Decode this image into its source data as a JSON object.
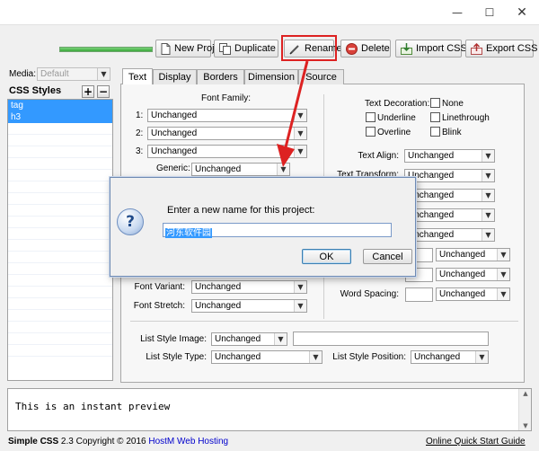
{
  "window": {
    "controls": {
      "minimize": "—",
      "maximize": "☐",
      "close": "✕"
    }
  },
  "toolbar": {
    "buttons": [
      {
        "id": "new_project",
        "label": "New Project",
        "icon": "document-icon"
      },
      {
        "id": "duplicate",
        "label": "Duplicate",
        "icon": "copy-icon"
      },
      {
        "id": "rename",
        "label": "Rename",
        "icon": "pencil-icon"
      },
      {
        "id": "delete",
        "label": "Delete",
        "icon": "delete-icon"
      },
      {
        "id": "import_css",
        "label": "Import CSS",
        "icon": "import-icon"
      },
      {
        "id": "export_css",
        "label": "Export CSS",
        "icon": "export-icon"
      }
    ],
    "highlight_color": "#dd2222"
  },
  "sidebar": {
    "media_label": "Media:",
    "media_value": "Default",
    "styles_title": "CSS Styles",
    "add_label": "+",
    "remove_label": "−",
    "items": [
      "tag",
      "h3"
    ]
  },
  "tabs": [
    "Text",
    "Display",
    "Borders",
    "Dimension",
    "Source"
  ],
  "active_tab": "Text",
  "font": {
    "family_title": "Font Family:",
    "rows": [
      {
        "label": "1:",
        "value": "Unchanged"
      },
      {
        "label": "2:",
        "value": "Unchanged"
      },
      {
        "label": "3:",
        "value": "Unchanged"
      }
    ],
    "generic_label": "Generic:",
    "generic_value": "Unchanged",
    "variant_label": "Font Variant:",
    "variant_value": "Unchanged",
    "stretch_label": "Font Stretch:",
    "stretch_value": "Unchanged"
  },
  "decoration": {
    "title": "Text Decoration:",
    "options": [
      "None",
      "Underline",
      "Linethrough",
      "Overline",
      "Blink"
    ]
  },
  "text_align": {
    "label": "Text Align:",
    "value": "Unchanged"
  },
  "text_transform": {
    "label": "Text Transform:",
    "value": "Unchanged"
  },
  "hidden_combos": [
    "Unchanged",
    "Unchanged",
    "Unchanged"
  ],
  "spacing_rows": [
    {
      "value": "Unchanged"
    },
    {
      "value": "Unchanged"
    },
    {
      "label": "Word Spacing:",
      "value": "Unchanged"
    }
  ],
  "list_style": {
    "image_label": "List Style Image:",
    "image_value": "Unchanged",
    "type_label": "List Style Type:",
    "type_value": "Unchanged",
    "position_label": "List Style Position:",
    "position_value": "Unchanged"
  },
  "preview": {
    "text": "This is an instant preview"
  },
  "status": {
    "app": "Simple CSS",
    "version_copy": " 2.3 Copyright © 2016 ",
    "company": "HostM",
    "company_suffix": " Web Hosting",
    "quick_start": "Online Quick Start Guide"
  },
  "dialog": {
    "prompt": "Enter a new name for this project:",
    "value": "河东软件园",
    "ok": "OK",
    "cancel": "Cancel",
    "icon": "question-icon"
  }
}
